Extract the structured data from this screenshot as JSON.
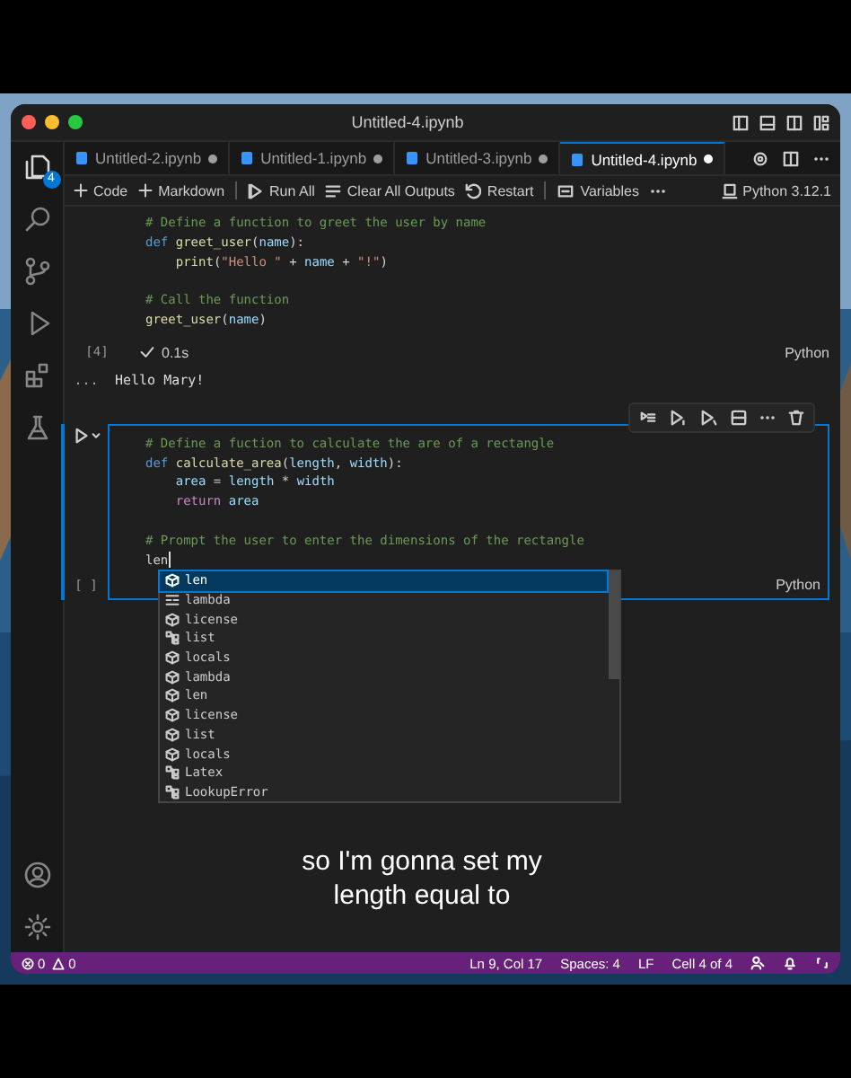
{
  "window": {
    "title": "Untitled-4.ipynb"
  },
  "activity_bar": {
    "badge": "4"
  },
  "tabs": [
    {
      "label": "Untitled-2.ipynb",
      "selected": false,
      "modified": true
    },
    {
      "label": "Untitled-1.ipynb",
      "selected": false,
      "modified": true
    },
    {
      "label": "Untitled-3.ipynb",
      "selected": false,
      "modified": true
    },
    {
      "label": "Untitled-4.ipynb",
      "selected": true,
      "modified": true
    }
  ],
  "toolbar": [
    {
      "kind": "add",
      "label": "Code"
    },
    {
      "kind": "add",
      "label": "Markdown"
    },
    {
      "kind": "run",
      "label": "Run All"
    },
    {
      "kind": "clear",
      "label": "Clear All Outputs"
    },
    {
      "kind": "restart",
      "label": "Restart"
    },
    {
      "kind": "variables",
      "label": "Variables"
    },
    {
      "kind": "more"
    },
    {
      "kind": "kernel",
      "label": "Python 3.12.1"
    }
  ],
  "cells": [
    {
      "focused": false,
      "count": "[4]",
      "status": {
        "check": true,
        "time": "0.1s"
      },
      "language": "Python",
      "output": "Hello Mary!",
      "output_gutter": "...",
      "lines": [
        {
          "gap_before": false,
          "tokens": [
            {
              "kind": "comment",
              "text": "# Define a function to greet the user by name"
            }
          ]
        },
        {
          "gap_before": false,
          "tokens": [
            {
              "kind": "keyword",
              "text": "def "
            },
            {
              "kind": "function",
              "text": "greet_user"
            },
            {
              "kind": "plain",
              "text": "("
            },
            {
              "kind": "param",
              "text": "name"
            },
            {
              "kind": "plain",
              "text": "):"
            }
          ]
        },
        {
          "gap_before": false,
          "tokens": [
            {
              "kind": "function",
              "text": "    print"
            },
            {
              "kind": "plain",
              "text": "("
            },
            {
              "kind": "string",
              "text": "\"Hello \""
            },
            {
              "kind": "plain",
              "text": " + "
            },
            {
              "kind": "param",
              "text": "name"
            },
            {
              "kind": "plain",
              "text": " + "
            },
            {
              "kind": "string",
              "text": "\"!\""
            },
            {
              "kind": "plain",
              "text": ")"
            }
          ]
        },
        {
          "gap_before": true,
          "tokens": [
            {
              "kind": "comment",
              "text": "# Call the function"
            }
          ]
        },
        {
          "gap_before": false,
          "tokens": [
            {
              "kind": "function",
              "text": "greet_user"
            },
            {
              "kind": "plain",
              "text": "("
            },
            {
              "kind": "param",
              "text": "name"
            },
            {
              "kind": "plain",
              "text": ")"
            }
          ]
        }
      ]
    },
    {
      "focused": true,
      "count": "[ ]",
      "language": "Python",
      "lines": [
        {
          "gap_before": false,
          "tokens": [
            {
              "kind": "comment",
              "text": "# Define a fuction to calculate the are of a rectangle"
            }
          ]
        },
        {
          "gap_before": false,
          "tokens": [
            {
              "kind": "keyword",
              "text": "def "
            },
            {
              "kind": "function",
              "text": "calculate_area"
            },
            {
              "kind": "plain",
              "text": "("
            },
            {
              "kind": "param",
              "text": "length"
            },
            {
              "kind": "plain",
              "text": ", "
            },
            {
              "kind": "param",
              "text": "width"
            },
            {
              "kind": "plain",
              "text": "):"
            }
          ]
        },
        {
          "gap_before": false,
          "tokens": [
            {
              "kind": "param",
              "text": "    area"
            },
            {
              "kind": "plain",
              "text": " = "
            },
            {
              "kind": "param",
              "text": "length"
            },
            {
              "kind": "plain",
              "text": " * "
            },
            {
              "kind": "param",
              "text": "width"
            }
          ]
        },
        {
          "gap_before": false,
          "tokens": [
            {
              "kind": "control",
              "text": "    return"
            },
            {
              "kind": "param",
              "text": " area"
            }
          ]
        },
        {
          "gap_before": true,
          "tokens": [
            {
              "kind": "comment",
              "text": "# Prompt the user to enter the dimensions of the rectangle"
            }
          ]
        },
        {
          "gap_before": false,
          "tokens": [
            {
              "kind": "plain",
              "text": "len"
            }
          ]
        }
      ]
    }
  ],
  "suggestions": [
    {
      "kind": "variable",
      "label": "len",
      "selected": true
    },
    {
      "kind": "keyword",
      "label": "lambda",
      "selected": false
    },
    {
      "kind": "variable",
      "label": "license",
      "selected": false
    },
    {
      "kind": "class",
      "label": "list",
      "selected": false
    },
    {
      "kind": "variable",
      "label": "locals",
      "selected": false
    },
    {
      "kind": "variable",
      "label": "lambda",
      "selected": false
    },
    {
      "kind": "variable",
      "label": "len",
      "selected": false
    },
    {
      "kind": "variable",
      "label": "license",
      "selected": false
    },
    {
      "kind": "variable",
      "label": "list",
      "selected": false
    },
    {
      "kind": "variable",
      "label": "locals",
      "selected": false
    },
    {
      "kind": "class",
      "label": "Latex",
      "selected": false
    },
    {
      "kind": "class",
      "label": "LookupError",
      "selected": false
    }
  ],
  "caption": "so I'm gonna set my length equal to",
  "status_bar": {
    "errors": "0",
    "warnings": "0",
    "items": [
      "Ln 9, Col 17",
      "Spaces: 4",
      "LF",
      "Cell 4 of 4"
    ]
  }
}
